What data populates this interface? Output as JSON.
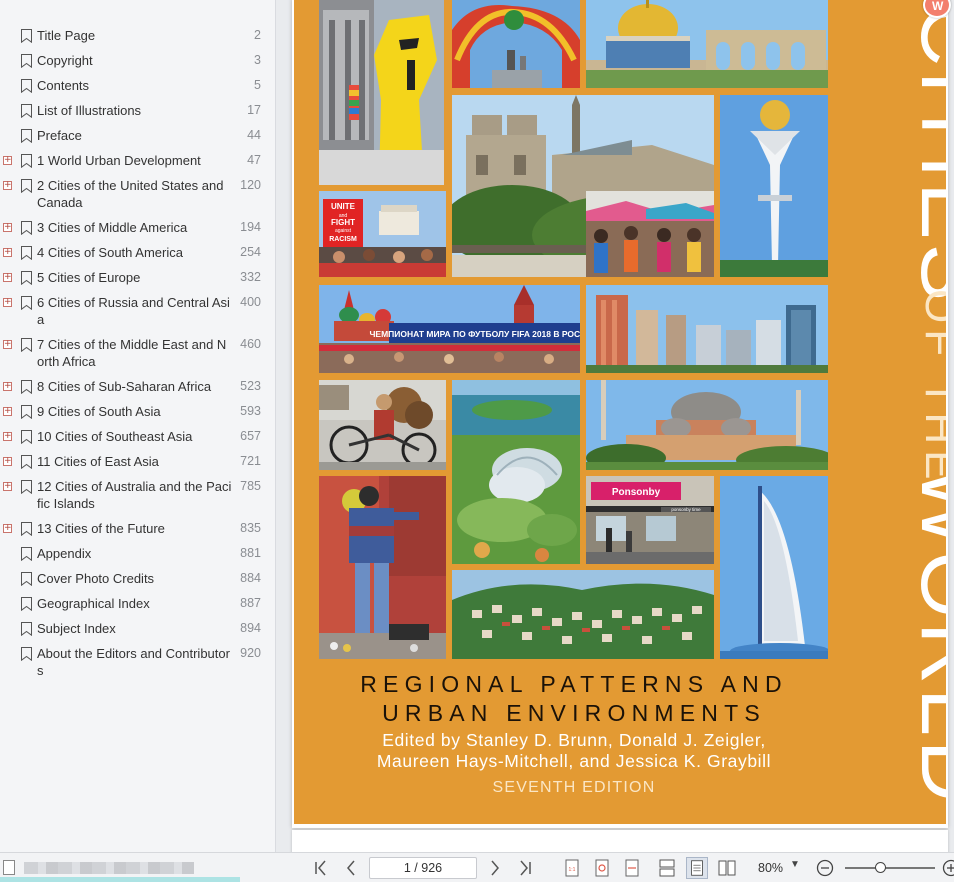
{
  "toc": [
    {
      "label": "Title Page",
      "page": "2",
      "expandable": false,
      "lines": 1
    },
    {
      "label": "Copyright",
      "page": "3",
      "expandable": false,
      "lines": 1
    },
    {
      "label": "Contents",
      "page": "5",
      "expandable": false,
      "lines": 1
    },
    {
      "label": "List of Illustrations",
      "page": "17",
      "expandable": false,
      "lines": 1
    },
    {
      "label": "Preface",
      "page": "44",
      "expandable": false,
      "lines": 1
    },
    {
      "label": "1 World Urban Development",
      "page": "47",
      "expandable": true,
      "lines": 1
    },
    {
      "label": "2 Cities of the United States and Canada",
      "page": "120",
      "expandable": true,
      "lines": 2
    },
    {
      "label": "3 Cities of Middle America",
      "page": "194",
      "expandable": true,
      "lines": 1
    },
    {
      "label": "4 Cities of South America",
      "page": "254",
      "expandable": true,
      "lines": 1
    },
    {
      "label": "5 Cities of Europe",
      "page": "332",
      "expandable": true,
      "lines": 1
    },
    {
      "label": "6 Cities of Russia and Central Asia",
      "page": "400",
      "expandable": true,
      "lines": 2
    },
    {
      "label": "7 Cities of the Middle East and North Africa",
      "page": "460",
      "expandable": true,
      "lines": 2
    },
    {
      "label": "8 Cities of Sub-Saharan Africa",
      "page": "523",
      "expandable": true,
      "lines": 1
    },
    {
      "label": "9 Cities of South Asia",
      "page": "593",
      "expandable": true,
      "lines": 1
    },
    {
      "label": "10 Cities of Southeast Asia",
      "page": "657",
      "expandable": true,
      "lines": 1
    },
    {
      "label": "11 Cities of East Asia",
      "page": "721",
      "expandable": true,
      "lines": 1
    },
    {
      "label": "12 Cities of Australia and the Pacific Islands",
      "page": "785",
      "expandable": true,
      "lines": 2
    },
    {
      "label": "13 Cities of the Future",
      "page": "835",
      "expandable": true,
      "lines": 1
    },
    {
      "label": "Appendix",
      "page": "881",
      "expandable": false,
      "lines": 1
    },
    {
      "label": "Cover Photo Credits",
      "page": "884",
      "expandable": false,
      "lines": 1
    },
    {
      "label": "Geographical Index",
      "page": "887",
      "expandable": false,
      "lines": 1
    },
    {
      "label": "Subject Index",
      "page": "894",
      "expandable": false,
      "lines": 1
    },
    {
      "label": "About the Editors and Contributors",
      "page": "920",
      "expandable": false,
      "lines": 2
    }
  ],
  "cover": {
    "title_line1": "CITIES",
    "title_line2": "OF THE",
    "title_line3": "WORLD",
    "subtitle_line1": "REGIONAL PATTERNS AND",
    "subtitle_line2": "URBAN ENVIRONMENTS",
    "editors_line1": "Edited by Stanley D. Brunn, Donald J. Zeigler,",
    "editors_line2": "Maureen Hays-Mitchell, and Jessica K. Graybill",
    "edition": "SEVENTH EDITION",
    "sign_unite": "UNITE",
    "sign_and": "and",
    "sign_fight": "FIGHT",
    "sign_against": "against",
    "sign_racism": "RACISM",
    "banner_text": "ЧЕМПИОНАТ МИРА ПО ФУТБОЛУ FIFA 2018 В РОССИИ",
    "shop_sign": "Ponsonby",
    "shop_sign2": "ponsonby time",
    "background_color": "#e39a33"
  },
  "toolbar": {
    "page_indicator": "1 / 926",
    "zoom": "80%",
    "zoom_caret": "▼",
    "actual_size_glyph": "1:1"
  },
  "colors": {
    "accent": "#f37f6d",
    "expander_border": "#c9746c"
  },
  "icons": {
    "app_badge": "app-badge-icon",
    "first_page": "first-page-icon",
    "prev_page": "prev-page-icon",
    "next_page": "next-page-icon",
    "last_page": "last-page-icon",
    "zoom_out": "zoom-out-icon",
    "zoom_in": "zoom-in-icon"
  }
}
